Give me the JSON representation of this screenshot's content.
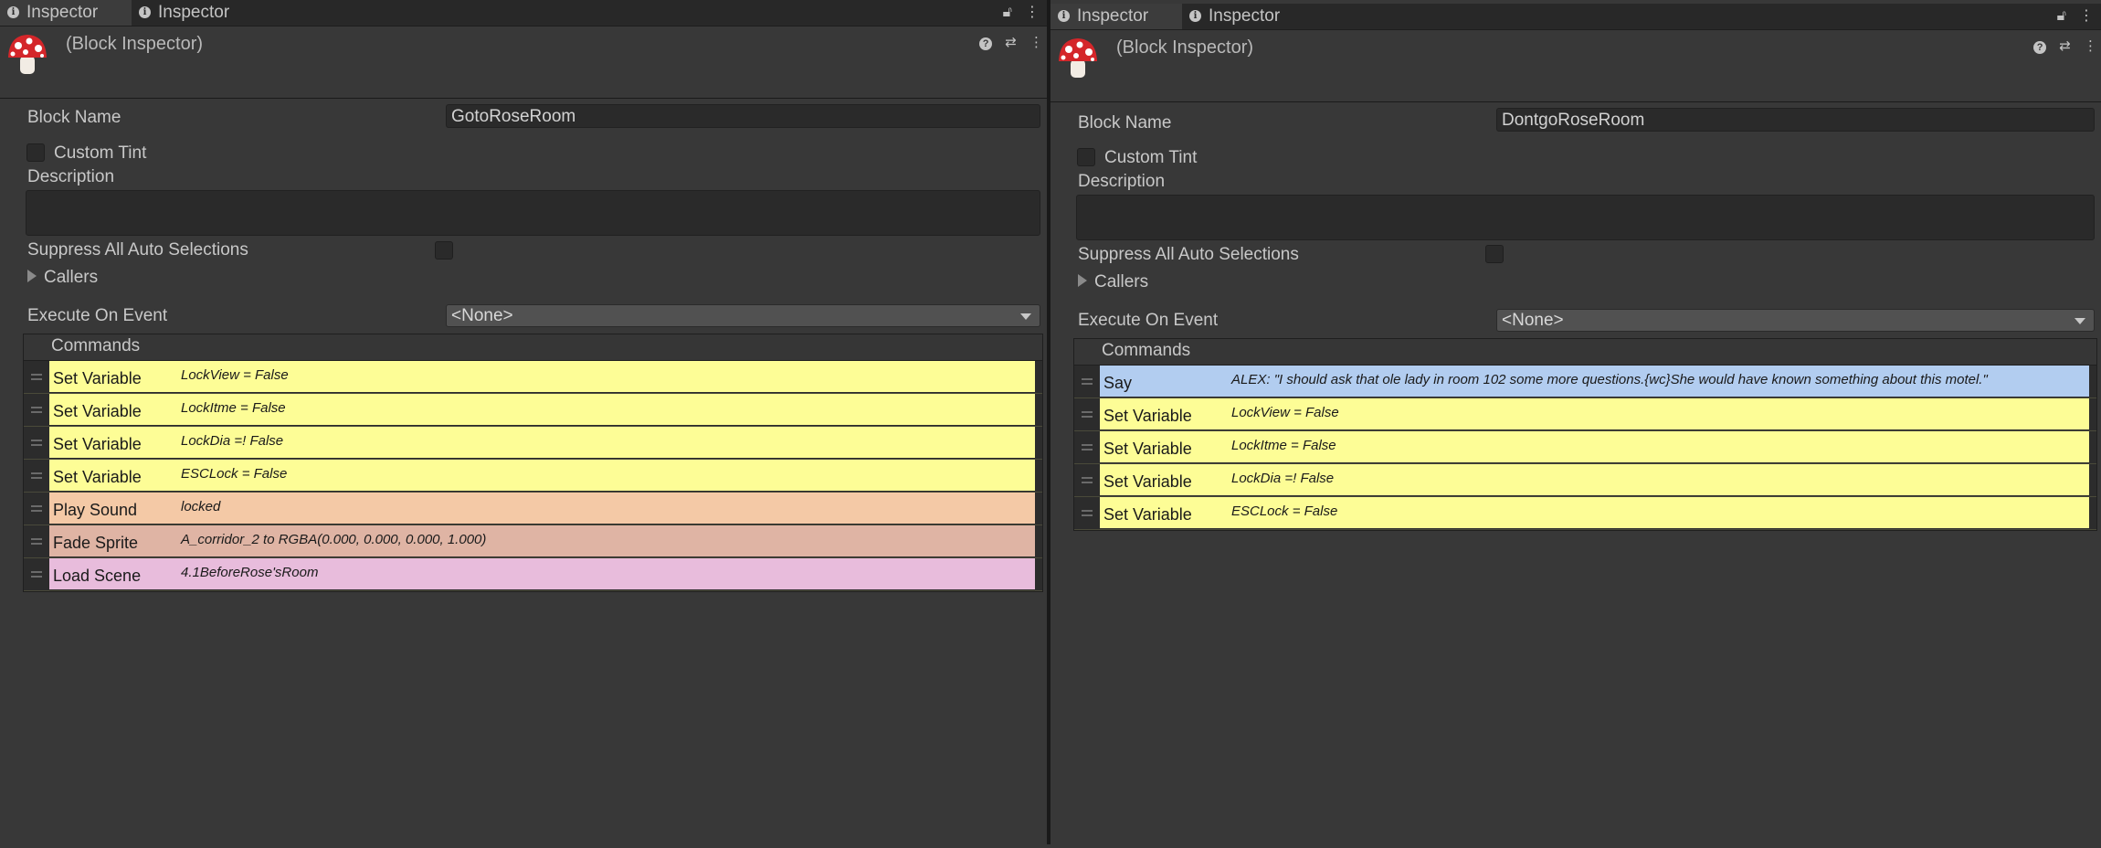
{
  "colors": {
    "variable": "#fdfd96",
    "sound": "#f4c9a6",
    "sprite": "#dfb4a4",
    "scene": "#e8bcdc",
    "say": "#b2cdf0"
  },
  "left": {
    "tabs": [
      {
        "label": "Inspector"
      },
      {
        "label": "Inspector"
      }
    ],
    "header_title": "(Block Inspector)",
    "block_name_label": "Block Name",
    "block_name_value": "GotoRoseRoom",
    "custom_tint_label": "Custom Tint",
    "description_label": "Description",
    "suppress_label": "Suppress All Auto Selections",
    "callers_label": "Callers",
    "execute_label": "Execute On Event",
    "execute_value": "<None>",
    "commands_label": "Commands",
    "commands": [
      {
        "name": "Set Variable",
        "summary": "LockView = False",
        "kind": "variable"
      },
      {
        "name": "Set Variable",
        "summary": "LockItme = False",
        "kind": "variable"
      },
      {
        "name": "Set Variable",
        "summary": "LockDia =! False",
        "kind": "variable"
      },
      {
        "name": "Set Variable",
        "summary": "ESCLock = False",
        "kind": "variable"
      },
      {
        "name": "Play Sound",
        "summary": "locked",
        "kind": "sound"
      },
      {
        "name": "Fade Sprite",
        "summary": "A_corridor_2 to RGBA(0.000, 0.000, 0.000, 1.000)",
        "kind": "sprite"
      },
      {
        "name": "Load Scene",
        "summary": "4.1BeforeRose'sRoom",
        "kind": "scene"
      }
    ]
  },
  "right": {
    "tabs": [
      {
        "label": "Inspector"
      },
      {
        "label": "Inspector"
      }
    ],
    "header_title": "(Block Inspector)",
    "block_name_label": "Block Name",
    "block_name_value": "DontgoRoseRoom",
    "custom_tint_label": "Custom Tint",
    "description_label": "Description",
    "suppress_label": "Suppress All Auto Selections",
    "callers_label": "Callers",
    "execute_label": "Execute On Event",
    "execute_value": "<None>",
    "commands_label": "Commands",
    "commands": [
      {
        "name": "Say",
        "summary": "ALEX: \"I should ask that ole lady in room 102 some more questions.{wc}She would have known something about this motel.\"",
        "kind": "say"
      },
      {
        "name": "Set Variable",
        "summary": "LockView = False",
        "kind": "variable"
      },
      {
        "name": "Set Variable",
        "summary": "LockItme = False",
        "kind": "variable"
      },
      {
        "name": "Set Variable",
        "summary": "LockDia =! False",
        "kind": "variable"
      },
      {
        "name": "Set Variable",
        "summary": "ESCLock = False",
        "kind": "variable"
      }
    ]
  }
}
